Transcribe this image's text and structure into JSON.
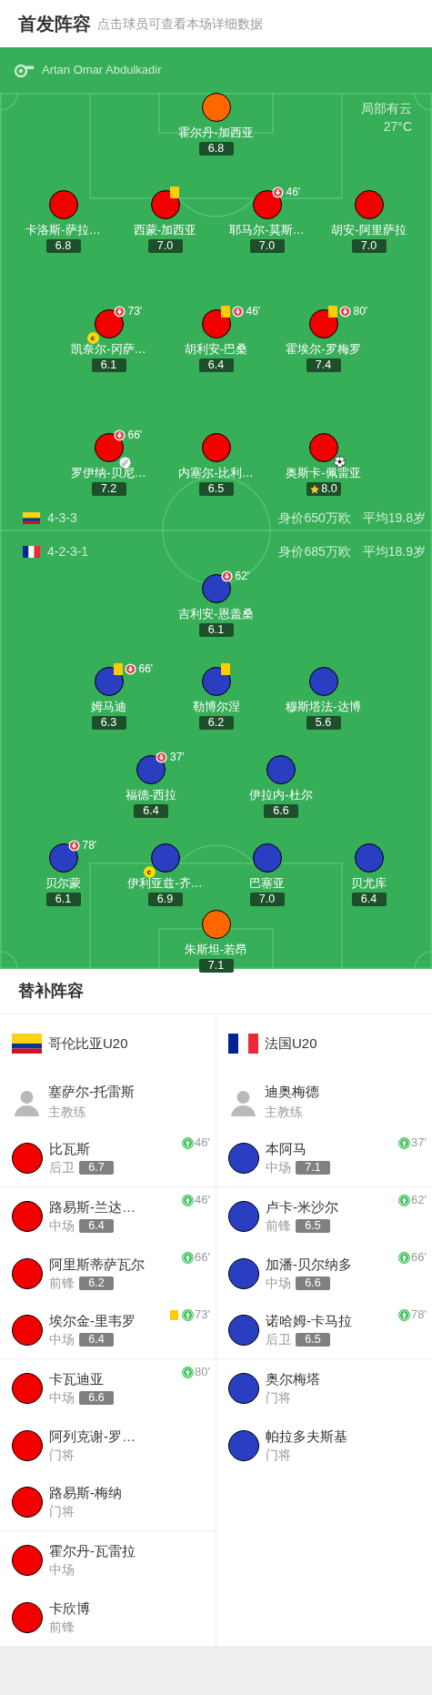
{
  "header": {
    "title": "首发阵容",
    "subtitle": "点击球员可查看本场详细数据"
  },
  "referee": "Artan Omar Abdulkadir",
  "weather": {
    "condition": "局部有云",
    "temperature": "27°C"
  },
  "home": {
    "flag": {
      "kind": "colombia"
    },
    "formation": "4-3-3",
    "value": "身价650万欧",
    "age": "平均19.8岁",
    "rows": [
      {
        "color": "#ff6600",
        "players": [
          {
            "name": "霍尔丹-加西亚",
            "rating": "6.8"
          }
        ]
      },
      {
        "color": "#f20000",
        "players": [
          {
            "name": "卡洛斯-萨拉…",
            "rating": "6.8"
          },
          {
            "name": "西蒙-加西亚",
            "rating": "7.0",
            "events": [
              {
                "kind": "yellow_card"
              }
            ]
          },
          {
            "name": "耶马尔-莫斯…",
            "rating": "7.0",
            "events": [
              {
                "kind": "sub_off",
                "minute": "46'"
              }
            ]
          },
          {
            "name": "胡安-阿里萨拉",
            "rating": "7.0"
          }
        ]
      },
      {
        "color": "#f20000",
        "players": [
          {
            "name": "凯奈尔-冈萨…",
            "rating": "6.1",
            "events": [
              {
                "kind": "sub_off",
                "minute": "73'"
              },
              {
                "kind": "captain",
                "label": "c"
              }
            ]
          },
          {
            "name": "胡利安-巴桑",
            "rating": "6.4",
            "events": [
              {
                "kind": "yellow_card"
              },
              {
                "kind": "sub_off",
                "minute": "46'"
              }
            ]
          },
          {
            "name": "霍埃尔-罗梅罗",
            "rating": "7.4",
            "events": [
              {
                "kind": "yellow_card"
              },
              {
                "kind": "sub_off",
                "minute": "80'"
              }
            ]
          }
        ]
      },
      {
        "color": "#f20000",
        "players": [
          {
            "name": "罗伊纳-贝尼…",
            "rating": "7.2",
            "events": [
              {
                "kind": "sub_off",
                "minute": "66'"
              },
              {
                "kind": "assist"
              }
            ]
          },
          {
            "name": "内塞尔-比利…",
            "rating": "6.5"
          },
          {
            "name": "奥斯卡-佩雷亚",
            "rating": "8.0",
            "events": [
              {
                "kind": "goal"
              },
              {
                "kind": "best_player"
              }
            ]
          }
        ]
      }
    ]
  },
  "away": {
    "flag": {
      "kind": "france"
    },
    "formation": "4-2-3-1",
    "value": "身价685万欧",
    "age": "平均18.9岁",
    "rows": [
      {
        "color": "#2a3ec1",
        "players": [
          {
            "name": "吉利安-恩盖桑",
            "rating": "6.1",
            "events": [
              {
                "kind": "sub_off",
                "minute": "62'"
              }
            ]
          }
        ]
      },
      {
        "color": "#2a3ec1",
        "players": [
          {
            "name": "姆马迪",
            "rating": "6.3",
            "events": [
              {
                "kind": "yellow_card"
              },
              {
                "kind": "sub_off",
                "minute": "66'"
              }
            ]
          },
          {
            "name": "勒博尔涅",
            "rating": "6.2",
            "events": [
              {
                "kind": "yellow_card"
              }
            ]
          },
          {
            "name": "穆斯塔法-达博",
            "rating": "5.6"
          }
        ]
      },
      {
        "color": "#2a3ec1",
        "players": [
          {
            "name": "福德-西拉",
            "rating": "6.4",
            "events": [
              {
                "kind": "sub_off",
                "minute": "37'"
              }
            ]
          },
          {
            "name": "伊拉内-杜尔",
            "rating": "6.6"
          }
        ]
      },
      {
        "color": "#2a3ec1",
        "players": [
          {
            "name": "贝尔蒙",
            "rating": "6.1",
            "events": [
              {
                "kind": "sub_off",
                "minute": "78'"
              }
            ]
          },
          {
            "name": "伊利亚兹-齐…",
            "rating": "6.9",
            "events": [
              {
                "kind": "captain",
                "label": "c"
              }
            ]
          },
          {
            "name": "巴塞亚",
            "rating": "7.0"
          },
          {
            "name": "贝尤库",
            "rating": "6.4"
          }
        ]
      },
      {
        "color": "#ff6600",
        "players": [
          {
            "name": "朱斯坦-若昂",
            "rating": "7.1"
          }
        ]
      }
    ]
  },
  "substitutes": {
    "title": "替补阵容",
    "teams": [
      {
        "flag": {
          "kind": "colombia"
        },
        "name": "哥伦比亚U20",
        "color": "#f20000",
        "coach": {
          "name": "塞萨尔-托雷斯",
          "role": "主教练"
        },
        "players": [
          {
            "name": "比瓦斯",
            "position": "后卫",
            "rating": "6.7",
            "events": [
              {
                "kind": "sub_on",
                "minute": "46'"
              }
            ]
          },
          {
            "name": "路易斯-兰达…",
            "position": "中场",
            "rating": "6.4",
            "events": [
              {
                "kind": "sub_on",
                "minute": "46'"
              }
            ]
          },
          {
            "name": "阿里斯蒂萨瓦尔",
            "position": "前锋",
            "rating": "6.2",
            "events": [
              {
                "kind": "sub_on",
                "minute": "66'"
              }
            ]
          },
          {
            "name": "埃尔金-里韦罗",
            "position": "中场",
            "rating": "6.4",
            "events": [
              {
                "kind": "yellow_card"
              },
              {
                "kind": "sub_on",
                "minute": "73'"
              }
            ]
          },
          {
            "name": "卡瓦迪亚",
            "position": "中场",
            "rating": "6.6",
            "events": [
              {
                "kind": "sub_on",
                "minute": "80'"
              }
            ]
          },
          {
            "name": "阿列克谢-罗…",
            "position": "门将"
          },
          {
            "name": "路易斯-梅纳",
            "position": "门将"
          },
          {
            "name": "霍尔丹-瓦雷拉",
            "position": "中场"
          },
          {
            "name": "卡欣博",
            "position": "前锋"
          }
        ]
      },
      {
        "flag": {
          "kind": "france"
        },
        "name": "法国U20",
        "color": "#2a3ec1",
        "coach": {
          "name": "迪奥梅德",
          "role": "主教练"
        },
        "players": [
          {
            "name": "本阿马",
            "position": "中场",
            "rating": "7.1",
            "events": [
              {
                "kind": "sub_on",
                "minute": "37'"
              }
            ]
          },
          {
            "name": "卢卡-米沙尔",
            "position": "前锋",
            "rating": "6.5",
            "events": [
              {
                "kind": "sub_on",
                "minute": "62'"
              }
            ]
          },
          {
            "name": "加潘-贝尔纳多",
            "position": "中场",
            "rating": "6.6",
            "events": [
              {
                "kind": "sub_on",
                "minute": "66'"
              }
            ]
          },
          {
            "name": "诺哈姆-卡马拉",
            "position": "后卫",
            "rating": "6.5",
            "events": [
              {
                "kind": "sub_on",
                "minute": "78'"
              }
            ]
          },
          {
            "name": "奥尔梅塔",
            "position": "门将"
          },
          {
            "name": "帕拉多夫斯基",
            "position": "门将"
          }
        ]
      }
    ]
  }
}
